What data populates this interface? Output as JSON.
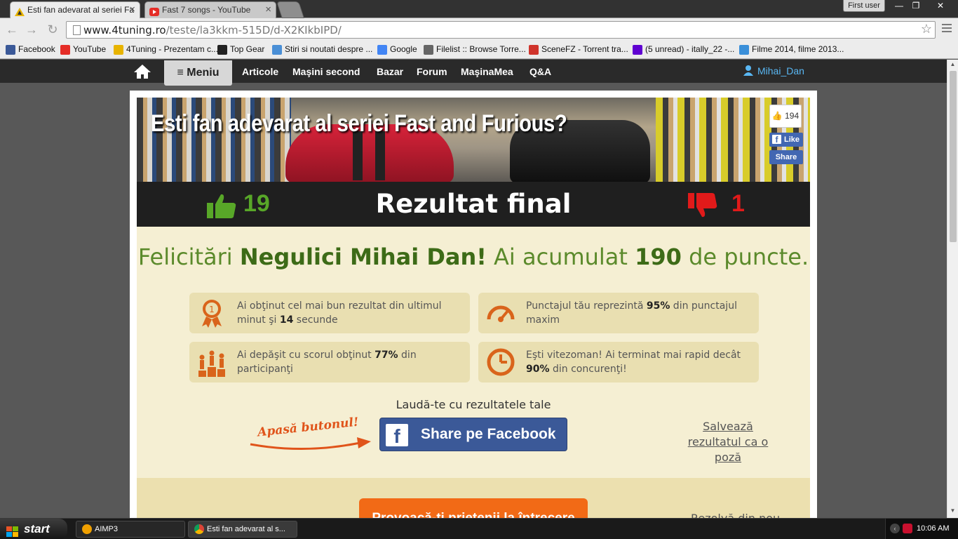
{
  "browser": {
    "tabs": [
      {
        "title": "Esti fan adevarat al seriei Fa",
        "icon": "4tuning-icon",
        "active": true
      },
      {
        "title": "Fast 7 songs - YouTube",
        "icon": "youtube-icon",
        "active": false
      }
    ],
    "profile_button": "First user",
    "window_controls": {
      "minimize": "—",
      "maximize": "❐",
      "close": "✕"
    },
    "url_host": "www.4tuning.ro",
    "url_path": "/teste/la3kkm-515D/d-X2KIkbIPD/",
    "bookmarks": [
      {
        "label": "Facebook",
        "icon": "facebook-icon",
        "color": "#3b5998"
      },
      {
        "label": "YouTube",
        "icon": "youtube-icon",
        "color": "#e52d27"
      },
      {
        "label": "4Tuning - Prezentam c...",
        "icon": "4tuning-icon",
        "color": "#e8b400"
      },
      {
        "label": "Top Gear",
        "icon": "topgear-icon",
        "color": "#222222"
      },
      {
        "label": "Stiri si noutati despre ...",
        "icon": "news-icon",
        "color": "#4a8fd6"
      },
      {
        "label": "Google",
        "icon": "google-icon",
        "color": "#4285f4"
      },
      {
        "label": "Filelist :: Browse Torre...",
        "icon": "filelist-icon",
        "color": "#666666"
      },
      {
        "label": "SceneFZ - Torrent tra...",
        "icon": "scenefz-icon",
        "color": "#d0342c"
      },
      {
        "label": "(5 unread) - itally_22 -...",
        "icon": "yahoo-icon",
        "color": "#5f01d1"
      },
      {
        "label": "Filme 2014, filme 2013...",
        "icon": "filme-icon",
        "color": "#3a8fd9"
      }
    ]
  },
  "site": {
    "nav": {
      "menu_label": "≡ Meniu",
      "links": [
        "Articole",
        "Maşini second",
        "Bazar",
        "Forum",
        "MaşinaMea",
        "Q&A"
      ],
      "user": "Mihai_Dan"
    },
    "quiz": {
      "title": "Esti fan adevarat al seriei Fast and Furious?",
      "fb_like_count": "194",
      "fb_like_label": "Like",
      "fb_share_label": "Share",
      "likes": "19",
      "dislikes": "1",
      "result_title": "Rezultat final",
      "congrats_prefix": "Felicitări ",
      "congrats_name": "Negulici Mihai Dan!",
      "congrats_middle": " Ai acumulat ",
      "congrats_points": "190",
      "congrats_suffix": " de puncte."
    },
    "stats": [
      {
        "icon": "medal-icon",
        "text_a": "Ai obţinut cel mai bun rezultat din ultimul minut şi ",
        "bold": "14",
        "text_b": " secunde"
      },
      {
        "icon": "gauge-icon",
        "text_a": "Punctajul tău reprezintă ",
        "bold": "95%",
        "text_b": " din punctajul maxim"
      },
      {
        "icon": "podium-icon",
        "text_a": "Ai depăşit cu scorul obţinut ",
        "bold": "77%",
        "text_b": " din participanţi"
      },
      {
        "icon": "clock-icon",
        "text_a": "Eşti vitezoman! Ai terminat mai rapid decât ",
        "bold": "90%",
        "text_b": " din concurenţi!"
      }
    ],
    "brag_label": "Laudă-te cu rezultatele tale",
    "press_button_label": "Apasă butonul!",
    "fb_share_big": "Share pe Facebook",
    "save_photo": "Salvează rezultatul ca o poză",
    "challenge_label": "Provoacă-ţi prietenii la întrecere",
    "redo_label": "Rezolvă din nou"
  },
  "taskbar": {
    "start": "start",
    "tasks": [
      {
        "label": "AIMP3",
        "icon": "aimp-icon"
      },
      {
        "label": "Esti fan adevarat al s...",
        "icon": "chrome-icon"
      }
    ],
    "clock": "10:06 AM"
  },
  "colors": {
    "accent_green": "#5b8a2b",
    "dislike_red": "#e11a1a",
    "facebook_blue": "#3b5998",
    "orange": "#f26a16",
    "cream": "#f5efd3"
  }
}
